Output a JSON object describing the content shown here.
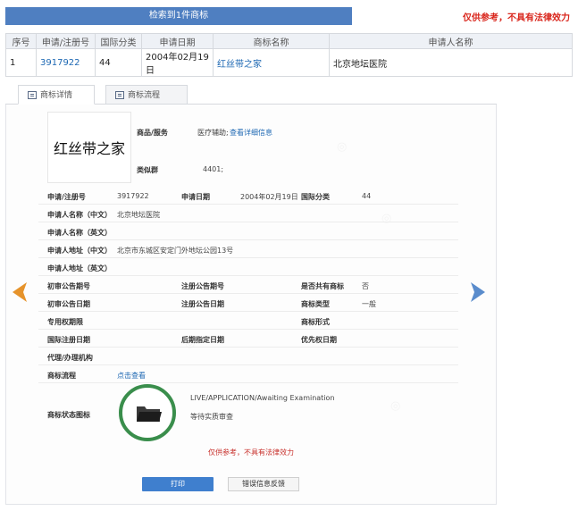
{
  "search": {
    "result_title": "检索到1件商标",
    "disclaimer": "仅供参考，不具有法律效力"
  },
  "results_table": {
    "headers": [
      "序号",
      "申请/注册号",
      "国际分类",
      "申请日期",
      "商标名称",
      "申请人名称"
    ],
    "rows": [
      [
        "1",
        "3917922",
        "44",
        "2004年02月19日",
        "红丝带之家",
        "北京地坛医院"
      ]
    ]
  },
  "tabs": [
    {
      "label": "商标详情",
      "icon": "document-icon",
      "active": true
    },
    {
      "label": "商标流程",
      "icon": "list-icon",
      "active": false
    }
  ],
  "detail": {
    "logo_text": "红丝带之家",
    "goods_services_label": "商品/服务",
    "goods_services_value": "医疗辅助;",
    "goods_services_link": "查看详细信息",
    "similar_group_label": "类似群",
    "similar_group_value": "4401;",
    "reg_no_label": "申请/注册号",
    "reg_no_value": "3917922",
    "app_date_label": "申请日期",
    "app_date_value": "2004年02月19日",
    "intl_class_label": "国际分类",
    "intl_class_value": "44",
    "applicant_cn_label": "申请人名称（中文）",
    "applicant_cn_value": "北京地坛医院",
    "applicant_en_label": "申请人名称（英文）",
    "address_cn_label": "申请人地址（中文）",
    "address_cn_value": "北京市东城区安定门外地坛公园13号",
    "address_en_label": "申请人地址（英文）",
    "prelim_pub_no_label": "初审公告期号",
    "reg_pub_no_label": "注册公告期号",
    "shared_label": "是否共有商标",
    "shared_value": "否",
    "prelim_pub_date_label": "初审公告日期",
    "reg_pub_date_label": "注册公告日期",
    "mark_type_label": "商标类型",
    "mark_type_value": "一般",
    "exclusive_period_label": "专用权期限",
    "mark_form_label": "商标形式",
    "intl_reg_date_label": "国际注册日期",
    "later_designation_label": "后期指定日期",
    "priority_date_label": "优先权日期",
    "agent_label": "代理/办理机构",
    "process_label": "商标流程",
    "process_link": "点击查看",
    "status_icon_label": "商标状态图标",
    "status_en": "LIVE/APPLICATION/Awaiting Examination",
    "status_cn": "等待实质审查",
    "disclaimer": "仅供参考，不具有法律效力",
    "print_button": "打印",
    "feedback_button": "错误信息反馈"
  },
  "colors": {
    "accent_blue": "#4f7fc1",
    "link_blue": "#1d68b3",
    "warning_red": "#d9261c",
    "status_green": "#3a8e4c",
    "arrow_prev": "#e6932b",
    "arrow_next": "#5a8ccc"
  }
}
